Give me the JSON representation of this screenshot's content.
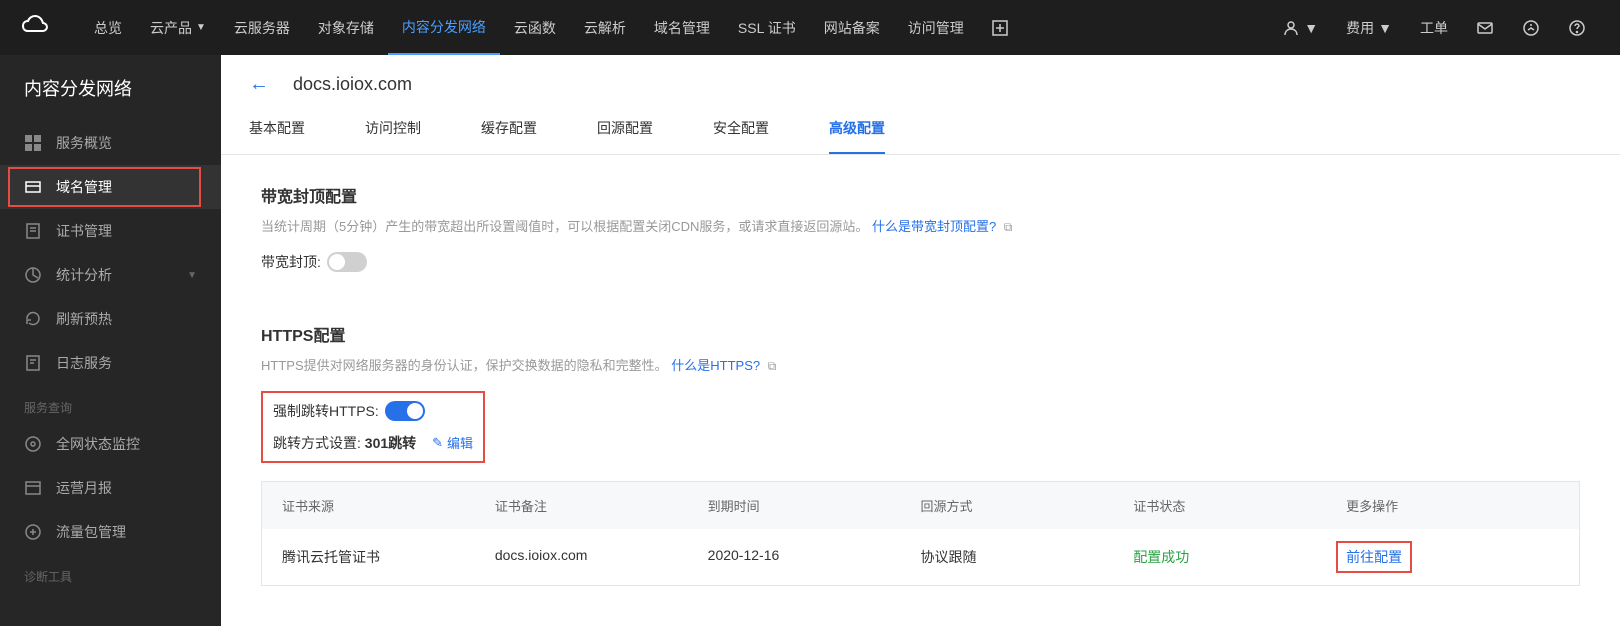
{
  "topbar": {
    "items": [
      "总览",
      "云产品",
      "云服务器",
      "对象存储",
      "内容分发网络",
      "云函数",
      "云解析",
      "域名管理",
      "SSL 证书",
      "网站备案",
      "访问管理"
    ],
    "active_index": 4,
    "right": {
      "fee": "费用",
      "ticket": "工单"
    }
  },
  "sidebar": {
    "title": "内容分发网络",
    "items": [
      {
        "label": "服务概览"
      },
      {
        "label": "域名管理",
        "active": true
      },
      {
        "label": "证书管理"
      },
      {
        "label": "统计分析",
        "expandable": true
      },
      {
        "label": "刷新预热"
      },
      {
        "label": "日志服务"
      }
    ],
    "section1": "服务查询",
    "items2": [
      {
        "label": "全网状态监控"
      },
      {
        "label": "运营月报"
      },
      {
        "label": "流量包管理"
      }
    ],
    "section2": "诊断工具"
  },
  "page": {
    "title": "docs.ioiox.com",
    "tabs": [
      "基本配置",
      "访问控制",
      "缓存配置",
      "回源配置",
      "安全配置",
      "高级配置"
    ],
    "active_tab": 5
  },
  "bandwidth": {
    "title": "带宽封顶配置",
    "desc_pre": "当统计周期（5分钟）产生的带宽超出所设置阈值时，可以根据配置关闭CDN服务，或请求直接返回源站。",
    "desc_link": "什么是带宽封顶配置?",
    "label": "带宽封顶:"
  },
  "https": {
    "title": "HTTPS配置",
    "desc_pre": "HTTPS提供对网络服务器的身份认证，保护交换数据的隐私和完整性。",
    "desc_link": "什么是HTTPS?",
    "force_label": "强制跳转HTTPS:",
    "redirect_label": "跳转方式设置: ",
    "redirect_value": "301跳转",
    "edit": "编辑"
  },
  "table": {
    "headers": [
      "证书来源",
      "证书备注",
      "到期时间",
      "回源方式",
      "证书状态",
      "更多操作"
    ],
    "row": {
      "source": "腾讯云托管证书",
      "note": "docs.ioiox.com",
      "expire": "2020-12-16",
      "origin": "协议跟随",
      "status": "配置成功",
      "action": "前往配置"
    }
  }
}
